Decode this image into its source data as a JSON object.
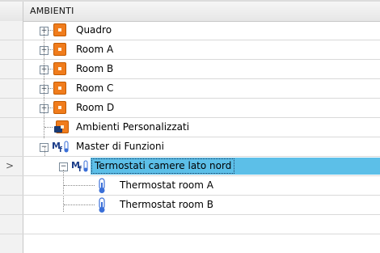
{
  "header": {
    "title": "AMBIENTI"
  },
  "rows": [
    {
      "label": "Quadro",
      "type": "room"
    },
    {
      "label": "Room A",
      "type": "room"
    },
    {
      "label": "Room B",
      "type": "room"
    },
    {
      "label": "Room C",
      "type": "room"
    },
    {
      "label": "Room D",
      "type": "room"
    },
    {
      "label": "Ambienti Personalizzati",
      "type": "custom"
    },
    {
      "label": "Master di Funzioni",
      "type": "master",
      "expanded": true
    },
    {
      "label": "Termostati camere lato nord",
      "type": "group",
      "selected": true,
      "expanded": true
    },
    {
      "label": "Thermostat room A",
      "type": "thermostat"
    },
    {
      "label": "Thermostat room B",
      "type": "thermostat"
    }
  ],
  "symbols": {
    "expand": "+",
    "collapse": "−",
    "row_pointer": ">"
  },
  "colors": {
    "room_icon": "#f07c1c",
    "selection": "#5cbfe8",
    "thermostat": "#3a6fd8",
    "master_icon": "#1d3e8a"
  }
}
